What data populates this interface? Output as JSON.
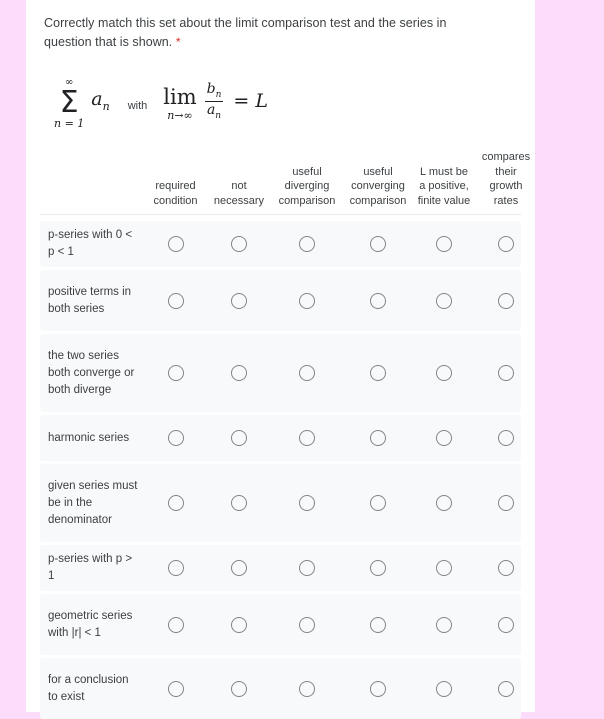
{
  "question": {
    "text": "Correctly match this set about the limit comparison test and the series in question that is shown.",
    "required_marker": "*"
  },
  "formula": {
    "sum_upper": "∞",
    "sum_symbol": "Σ",
    "sum_lower": "n = 1",
    "sum_term": "a",
    "sum_term_sub": "n",
    "connector": "with",
    "lim_word": "lim",
    "lim_sub": "n→∞",
    "numerator": "b",
    "numerator_sub": "n",
    "denominator": "a",
    "denominator_sub": "n",
    "equals": "=",
    "result": "L"
  },
  "grid": {
    "columns": [
      "required condition",
      "not necessary",
      "useful diverging comparison",
      "useful converging comparison",
      "L must be a positive, finite value",
      "compares their growth rates"
    ],
    "rows": [
      "p-series with 0 < p < 1",
      "positive terms in both series",
      "the two series both converge or both diverge",
      "harmonic series",
      "given series must be in the denominator",
      "p-series with p > 1",
      "geometric series with |r| < 1",
      "for a conclusion to exist"
    ],
    "selected": [
      null,
      null,
      null,
      null,
      null,
      null,
      null,
      null
    ]
  },
  "colors": {
    "page_background": "#ffffff",
    "outer_background": "#fbdcfb",
    "row_background": "#f8f9fa",
    "text": "#3c4043",
    "required_star": "#d93025",
    "radio_border": "#80868b"
  }
}
